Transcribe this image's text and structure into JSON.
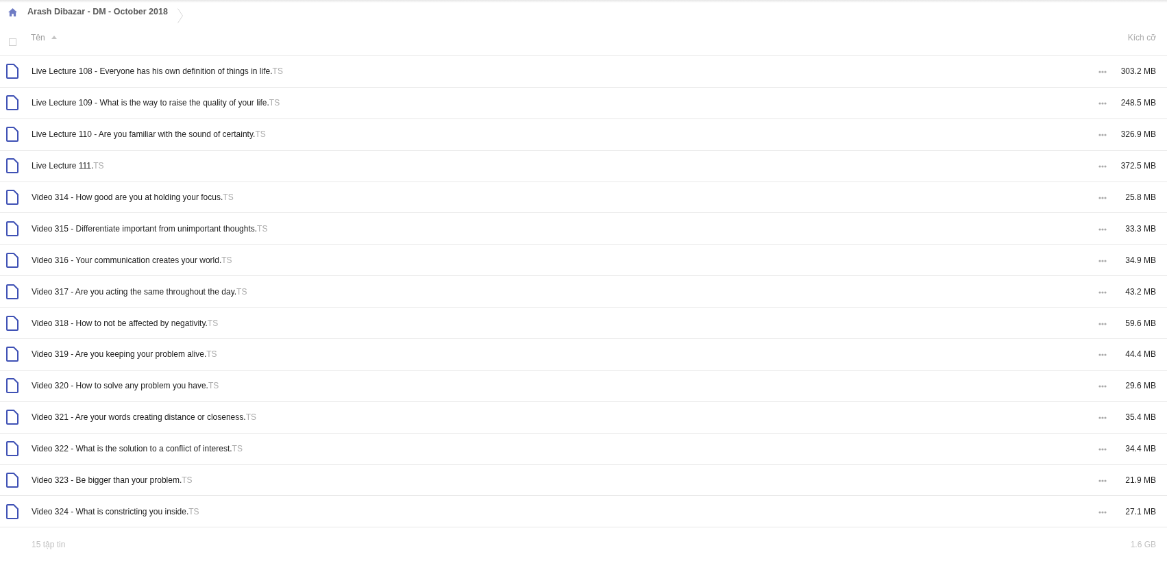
{
  "breadcrumb": {
    "items": [
      {
        "label": "Arash Dibazar - DM - October 2018"
      }
    ]
  },
  "table": {
    "select_all": {
      "checked": false
    },
    "columns": [
      {
        "label": "Tên",
        "sorted": true
      },
      {
        "label": "Kích cỡ"
      }
    ],
    "rows": [
      {
        "name": "Live Lecture 108 - Everyone has his own definition of things in life.TS",
        "size": "303.2 MB"
      },
      {
        "name": "Live Lecture 109 - What is the way to raise the quality of your life.TS",
        "size": "248.5 MB"
      },
      {
        "name": "Live Lecture 110 - Are you familiar with the sound of certainty.TS",
        "size": "326.9 MB"
      },
      {
        "name": "Live Lecture 111.TS",
        "size": "372.5 MB"
      },
      {
        "name": "Video 314 - How good are you at holding your focus.TS",
        "size": "25.8 MB"
      },
      {
        "name": "Video 315 - Differentiate important from unimportant thoughts.TS",
        "size": "33.3 MB"
      },
      {
        "name": "Video 316 - Your communication creates your world.TS",
        "size": "34.9 MB"
      },
      {
        "name": "Video 317 - Are you acting the same throughout the day.TS",
        "size": "43.2 MB"
      },
      {
        "name": "Video 318 - How to not be affected by negativity.TS",
        "size": "59.6 MB"
      },
      {
        "name": "Video 319 - Are you keeping your problem alive.TS",
        "size": "44.4 MB"
      },
      {
        "name": "Video 320 - How to solve any problem you have.TS",
        "size": "29.6 MB"
      },
      {
        "name": "Video 321 - Are your words creating distance or closeness.TS",
        "size": "35.4 MB"
      },
      {
        "name": "Video 322 - What is the solution to a conflict of interest.TS",
        "size": "34.4 MB"
      },
      {
        "name": "Video 323 - Be bigger than your problem.TS",
        "size": "21.9 MB"
      },
      {
        "name": "Video 324 - What is constricting you inside.TS",
        "size": "27.1 MB"
      }
    ]
  },
  "footer": {
    "count": "15 tập tin",
    "total": "1.6 GB"
  }
}
